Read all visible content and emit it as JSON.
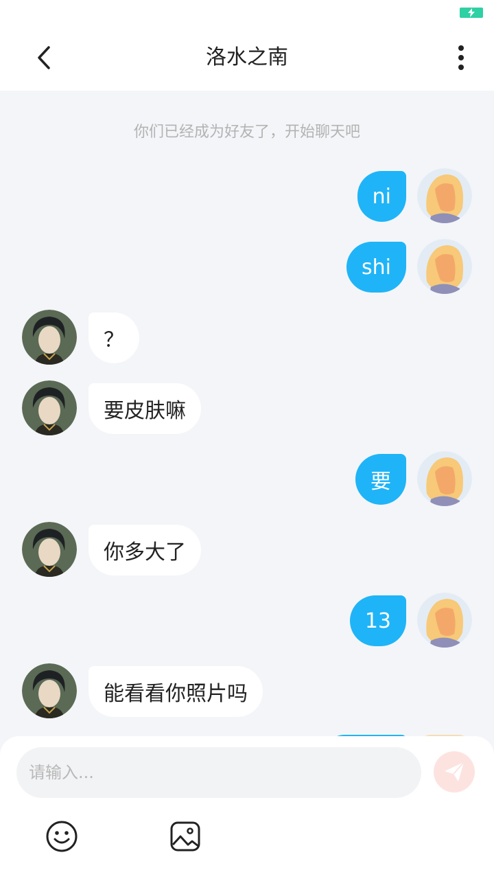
{
  "header": {
    "title": "洛水之南",
    "back_icon": "chevron-left-icon",
    "more_icon": "more-vertical-icon"
  },
  "chat": {
    "system_message": "你们已经成为好友了，开始聊天吧",
    "messages": [
      {
        "sender": "me",
        "text": "ni"
      },
      {
        "sender": "me",
        "text": "shi"
      },
      {
        "sender": "other",
        "text": "？"
      },
      {
        "sender": "other",
        "text": "要皮肤嘛"
      },
      {
        "sender": "me",
        "text": "要"
      },
      {
        "sender": "other",
        "text": "你多大了"
      },
      {
        "sender": "me",
        "text": "13"
      },
      {
        "sender": "other",
        "text": "能看看你照片吗"
      }
    ]
  },
  "input": {
    "placeholder": "请输入...",
    "value": "",
    "send_icon": "send-icon",
    "emoji_icon": "emoji-smile-icon",
    "image_icon": "image-icon"
  },
  "colors": {
    "accent": "#1fb4f7",
    "background": "#f3f5f8",
    "send_button": "#fde3e0",
    "battery": "#2ed0a4"
  }
}
